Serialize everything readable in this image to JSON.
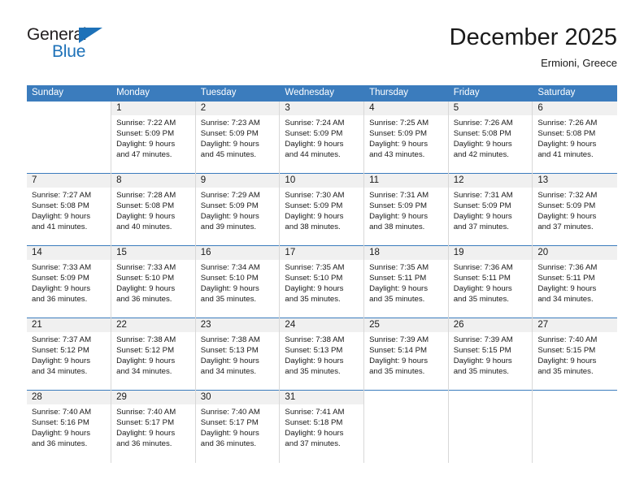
{
  "brand": {
    "name_top": "General",
    "name_bottom": "Blue",
    "accent_color": "#1d71b8",
    "triangle_icon": "triangle-icon"
  },
  "header": {
    "title": "December 2025",
    "subtitle": "Ermioni, Greece"
  },
  "calendar": {
    "header_bg": "#3b7cbd",
    "daynum_bg": "#f0f0f0",
    "weekdays": [
      "Sunday",
      "Monday",
      "Tuesday",
      "Wednesday",
      "Thursday",
      "Friday",
      "Saturday"
    ],
    "weeks": [
      [
        {
          "day": "",
          "sunrise": "",
          "sunset": "",
          "daylight_a": "",
          "daylight_b": ""
        },
        {
          "day": "1",
          "sunrise": "Sunrise: 7:22 AM",
          "sunset": "Sunset: 5:09 PM",
          "daylight_a": "Daylight: 9 hours",
          "daylight_b": "and 47 minutes."
        },
        {
          "day": "2",
          "sunrise": "Sunrise: 7:23 AM",
          "sunset": "Sunset: 5:09 PM",
          "daylight_a": "Daylight: 9 hours",
          "daylight_b": "and 45 minutes."
        },
        {
          "day": "3",
          "sunrise": "Sunrise: 7:24 AM",
          "sunset": "Sunset: 5:09 PM",
          "daylight_a": "Daylight: 9 hours",
          "daylight_b": "and 44 minutes."
        },
        {
          "day": "4",
          "sunrise": "Sunrise: 7:25 AM",
          "sunset": "Sunset: 5:09 PM",
          "daylight_a": "Daylight: 9 hours",
          "daylight_b": "and 43 minutes."
        },
        {
          "day": "5",
          "sunrise": "Sunrise: 7:26 AM",
          "sunset": "Sunset: 5:08 PM",
          "daylight_a": "Daylight: 9 hours",
          "daylight_b": "and 42 minutes."
        },
        {
          "day": "6",
          "sunrise": "Sunrise: 7:26 AM",
          "sunset": "Sunset: 5:08 PM",
          "daylight_a": "Daylight: 9 hours",
          "daylight_b": "and 41 minutes."
        }
      ],
      [
        {
          "day": "7",
          "sunrise": "Sunrise: 7:27 AM",
          "sunset": "Sunset: 5:08 PM",
          "daylight_a": "Daylight: 9 hours",
          "daylight_b": "and 41 minutes."
        },
        {
          "day": "8",
          "sunrise": "Sunrise: 7:28 AM",
          "sunset": "Sunset: 5:08 PM",
          "daylight_a": "Daylight: 9 hours",
          "daylight_b": "and 40 minutes."
        },
        {
          "day": "9",
          "sunrise": "Sunrise: 7:29 AM",
          "sunset": "Sunset: 5:09 PM",
          "daylight_a": "Daylight: 9 hours",
          "daylight_b": "and 39 minutes."
        },
        {
          "day": "10",
          "sunrise": "Sunrise: 7:30 AM",
          "sunset": "Sunset: 5:09 PM",
          "daylight_a": "Daylight: 9 hours",
          "daylight_b": "and 38 minutes."
        },
        {
          "day": "11",
          "sunrise": "Sunrise: 7:31 AM",
          "sunset": "Sunset: 5:09 PM",
          "daylight_a": "Daylight: 9 hours",
          "daylight_b": "and 38 minutes."
        },
        {
          "day": "12",
          "sunrise": "Sunrise: 7:31 AM",
          "sunset": "Sunset: 5:09 PM",
          "daylight_a": "Daylight: 9 hours",
          "daylight_b": "and 37 minutes."
        },
        {
          "day": "13",
          "sunrise": "Sunrise: 7:32 AM",
          "sunset": "Sunset: 5:09 PM",
          "daylight_a": "Daylight: 9 hours",
          "daylight_b": "and 37 minutes."
        }
      ],
      [
        {
          "day": "14",
          "sunrise": "Sunrise: 7:33 AM",
          "sunset": "Sunset: 5:09 PM",
          "daylight_a": "Daylight: 9 hours",
          "daylight_b": "and 36 minutes."
        },
        {
          "day": "15",
          "sunrise": "Sunrise: 7:33 AM",
          "sunset": "Sunset: 5:10 PM",
          "daylight_a": "Daylight: 9 hours",
          "daylight_b": "and 36 minutes."
        },
        {
          "day": "16",
          "sunrise": "Sunrise: 7:34 AM",
          "sunset": "Sunset: 5:10 PM",
          "daylight_a": "Daylight: 9 hours",
          "daylight_b": "and 35 minutes."
        },
        {
          "day": "17",
          "sunrise": "Sunrise: 7:35 AM",
          "sunset": "Sunset: 5:10 PM",
          "daylight_a": "Daylight: 9 hours",
          "daylight_b": "and 35 minutes."
        },
        {
          "day": "18",
          "sunrise": "Sunrise: 7:35 AM",
          "sunset": "Sunset: 5:11 PM",
          "daylight_a": "Daylight: 9 hours",
          "daylight_b": "and 35 minutes."
        },
        {
          "day": "19",
          "sunrise": "Sunrise: 7:36 AM",
          "sunset": "Sunset: 5:11 PM",
          "daylight_a": "Daylight: 9 hours",
          "daylight_b": "and 35 minutes."
        },
        {
          "day": "20",
          "sunrise": "Sunrise: 7:36 AM",
          "sunset": "Sunset: 5:11 PM",
          "daylight_a": "Daylight: 9 hours",
          "daylight_b": "and 34 minutes."
        }
      ],
      [
        {
          "day": "21",
          "sunrise": "Sunrise: 7:37 AM",
          "sunset": "Sunset: 5:12 PM",
          "daylight_a": "Daylight: 9 hours",
          "daylight_b": "and 34 minutes."
        },
        {
          "day": "22",
          "sunrise": "Sunrise: 7:38 AM",
          "sunset": "Sunset: 5:12 PM",
          "daylight_a": "Daylight: 9 hours",
          "daylight_b": "and 34 minutes."
        },
        {
          "day": "23",
          "sunrise": "Sunrise: 7:38 AM",
          "sunset": "Sunset: 5:13 PM",
          "daylight_a": "Daylight: 9 hours",
          "daylight_b": "and 34 minutes."
        },
        {
          "day": "24",
          "sunrise": "Sunrise: 7:38 AM",
          "sunset": "Sunset: 5:13 PM",
          "daylight_a": "Daylight: 9 hours",
          "daylight_b": "and 35 minutes."
        },
        {
          "day": "25",
          "sunrise": "Sunrise: 7:39 AM",
          "sunset": "Sunset: 5:14 PM",
          "daylight_a": "Daylight: 9 hours",
          "daylight_b": "and 35 minutes."
        },
        {
          "day": "26",
          "sunrise": "Sunrise: 7:39 AM",
          "sunset": "Sunset: 5:15 PM",
          "daylight_a": "Daylight: 9 hours",
          "daylight_b": "and 35 minutes."
        },
        {
          "day": "27",
          "sunrise": "Sunrise: 7:40 AM",
          "sunset": "Sunset: 5:15 PM",
          "daylight_a": "Daylight: 9 hours",
          "daylight_b": "and 35 minutes."
        }
      ],
      [
        {
          "day": "28",
          "sunrise": "Sunrise: 7:40 AM",
          "sunset": "Sunset: 5:16 PM",
          "daylight_a": "Daylight: 9 hours",
          "daylight_b": "and 36 minutes."
        },
        {
          "day": "29",
          "sunrise": "Sunrise: 7:40 AM",
          "sunset": "Sunset: 5:17 PM",
          "daylight_a": "Daylight: 9 hours",
          "daylight_b": "and 36 minutes."
        },
        {
          "day": "30",
          "sunrise": "Sunrise: 7:40 AM",
          "sunset": "Sunset: 5:17 PM",
          "daylight_a": "Daylight: 9 hours",
          "daylight_b": "and 36 minutes."
        },
        {
          "day": "31",
          "sunrise": "Sunrise: 7:41 AM",
          "sunset": "Sunset: 5:18 PM",
          "daylight_a": "Daylight: 9 hours",
          "daylight_b": "and 37 minutes."
        },
        {
          "day": "",
          "sunrise": "",
          "sunset": "",
          "daylight_a": "",
          "daylight_b": ""
        },
        {
          "day": "",
          "sunrise": "",
          "sunset": "",
          "daylight_a": "",
          "daylight_b": ""
        },
        {
          "day": "",
          "sunrise": "",
          "sunset": "",
          "daylight_a": "",
          "daylight_b": ""
        }
      ]
    ]
  }
}
